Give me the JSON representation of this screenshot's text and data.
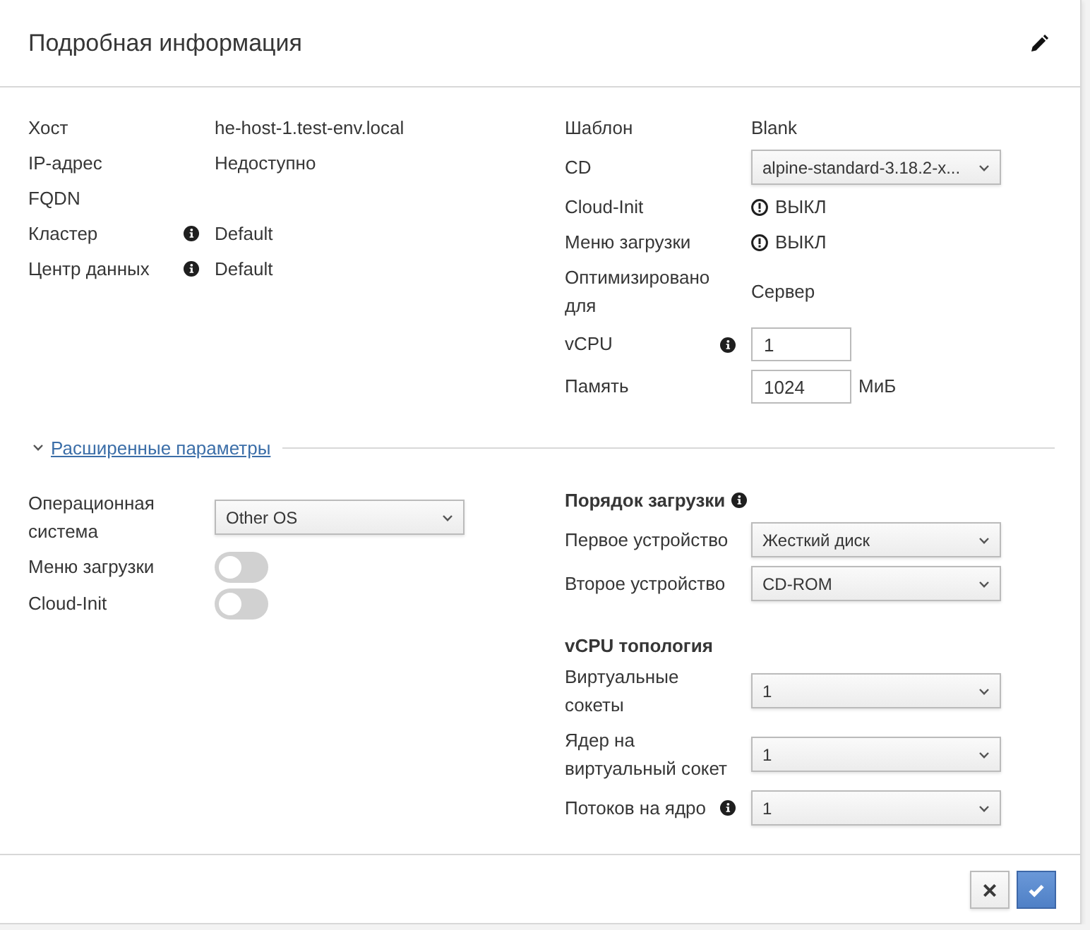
{
  "header": {
    "title": "Подробная информация"
  },
  "general": {
    "left": [
      {
        "kind": "text",
        "label": "Хост",
        "info": false,
        "value": "he-host-1.test-env.local"
      },
      {
        "kind": "text",
        "label": "IP-адрес",
        "info": false,
        "value": "Недоступно"
      },
      {
        "kind": "text",
        "label": "FQDN",
        "info": false
      },
      {
        "kind": "text",
        "label": "Кластер",
        "info": true,
        "value": "Default"
      },
      {
        "kind": "text",
        "label": "Центр данных",
        "info": true,
        "value": "Default"
      }
    ],
    "right": [
      {
        "kind": "text",
        "label": "Шаблон",
        "info": false,
        "value": "Blank"
      },
      {
        "kind": "select",
        "label": "CD",
        "info": false,
        "value": "alpine-standard-3.18.2-x..."
      },
      {
        "kind": "status",
        "label": "Cloud-Init",
        "info": false,
        "value": "ВЫКЛ"
      },
      {
        "kind": "status",
        "label": "Меню загрузки",
        "info": false,
        "value": "ВЫКЛ"
      },
      {
        "kind": "text",
        "label": "Оптимизировано для",
        "info": false,
        "value": "Сервер"
      },
      {
        "kind": "input",
        "label": "vCPU",
        "info": true,
        "value": "1"
      },
      {
        "kind": "input",
        "label": "Память",
        "info": false,
        "value": "1024",
        "unit": "МиБ"
      }
    ]
  },
  "advanced": {
    "label": "Расширенные параметры",
    "expanded": true,
    "left": [
      {
        "kind": "select",
        "label": "Операционная система",
        "info": false,
        "value": "Other OS"
      },
      {
        "kind": "toggle",
        "label": "Меню загрузки",
        "info": false,
        "on": false
      },
      {
        "kind": "toggle",
        "label": "Cloud-Init",
        "info": false,
        "on": false
      }
    ],
    "boot_order": {
      "title": "Порядок загрузки",
      "info": true,
      "rows": [
        {
          "kind": "select",
          "label": "Первое устройство",
          "info": false,
          "value": "Жесткий диск"
        },
        {
          "kind": "select",
          "label": "Второе устройство",
          "info": false,
          "value": "CD-ROM"
        }
      ]
    },
    "vcpu_topology": {
      "title": "vCPU топология",
      "info": false,
      "rows": [
        {
          "kind": "select",
          "label": "Виртуальные сокеты",
          "info": false,
          "value": "1"
        },
        {
          "kind": "select",
          "label": "Ядер на виртуальный сокет",
          "info": false,
          "value": "1"
        },
        {
          "kind": "select",
          "label": "Потоков на ядро",
          "info": true,
          "value": "1"
        }
      ]
    }
  },
  "footer": {
    "buttons": [
      {
        "kind": "cancel"
      },
      {
        "kind": "confirm"
      }
    ]
  }
}
